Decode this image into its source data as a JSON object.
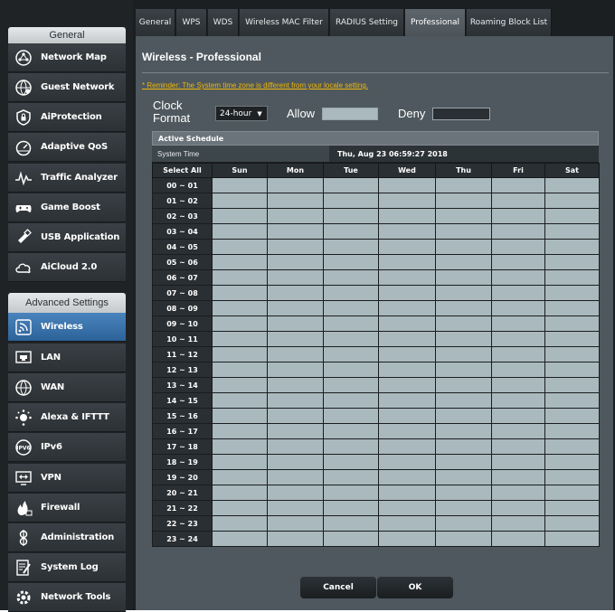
{
  "sidebar": {
    "general_header": "General",
    "general_items": [
      {
        "label": "Network Map",
        "icon": "network-map-icon"
      },
      {
        "label": "Guest Network",
        "icon": "guest-network-icon"
      },
      {
        "label": "AiProtection",
        "icon": "shield-lock-icon"
      },
      {
        "label": "Adaptive QoS",
        "icon": "speedometer-icon"
      },
      {
        "label": "Traffic Analyzer",
        "icon": "traffic-analyzer-icon"
      },
      {
        "label": "Game Boost",
        "icon": "gamepad-icon"
      },
      {
        "label": "USB Application",
        "icon": "usb-icon"
      },
      {
        "label": "AiCloud 2.0",
        "icon": "cloud-icon"
      }
    ],
    "advanced_header": "Advanced Settings",
    "advanced_items": [
      {
        "label": "Wireless",
        "icon": "wireless-icon",
        "active": true
      },
      {
        "label": "LAN",
        "icon": "lan-icon"
      },
      {
        "label": "WAN",
        "icon": "globe-icon"
      },
      {
        "label": "Alexa & IFTTT",
        "icon": "alexa-icon"
      },
      {
        "label": "IPv6",
        "icon": "ipv6-icon"
      },
      {
        "label": "VPN",
        "icon": "vpn-icon"
      },
      {
        "label": "Firewall",
        "icon": "firewall-icon"
      },
      {
        "label": "Administration",
        "icon": "administration-icon"
      },
      {
        "label": "System Log",
        "icon": "system-log-icon"
      },
      {
        "label": "Network Tools",
        "icon": "network-tools-icon"
      }
    ]
  },
  "tabs": [
    {
      "label": "General"
    },
    {
      "label": "WPS"
    },
    {
      "label": "WDS"
    },
    {
      "label": "Wireless MAC Filter"
    },
    {
      "label": "RADIUS Setting"
    },
    {
      "label": "Professional",
      "active": true
    },
    {
      "label": "Roaming Block List"
    }
  ],
  "page": {
    "title": "Wireless - Professional",
    "reminder": "* Reminder: The System time zone is different from your locale setting."
  },
  "controls": {
    "clock_format_label_line1": "Clock",
    "clock_format_label_line2": "Format",
    "clock_format_value": "24-hour",
    "allow_label": "Allow",
    "deny_label": "Deny"
  },
  "schedule": {
    "header": "Active Schedule",
    "system_time_label": "System Time",
    "system_time_value": "Thu, Aug 23 06:59:27 2018",
    "select_all": "Select All",
    "days": [
      "Sun",
      "Mon",
      "Tue",
      "Wed",
      "Thu",
      "Fri",
      "Sat"
    ],
    "hours": [
      "00 ~ 01",
      "01 ~ 02",
      "02 ~ 03",
      "03 ~ 04",
      "04 ~ 05",
      "05 ~ 06",
      "06 ~ 07",
      "07 ~ 08",
      "08 ~ 09",
      "09 ~ 10",
      "10 ~ 11",
      "11 ~ 12",
      "12 ~ 13",
      "13 ~ 14",
      "14 ~ 15",
      "15 ~ 16",
      "16 ~ 17",
      "17 ~ 18",
      "18 ~ 19",
      "19 ~ 20",
      "20 ~ 21",
      "21 ~ 22",
      "22 ~ 23",
      "23 ~ 24"
    ]
  },
  "buttons": {
    "cancel": "Cancel",
    "ok": "OK"
  },
  "colors": {
    "allow": "#a9b9be",
    "deny": "#2a2f33",
    "reminder": "#f2b705",
    "active_nav": "#3b78b4"
  }
}
